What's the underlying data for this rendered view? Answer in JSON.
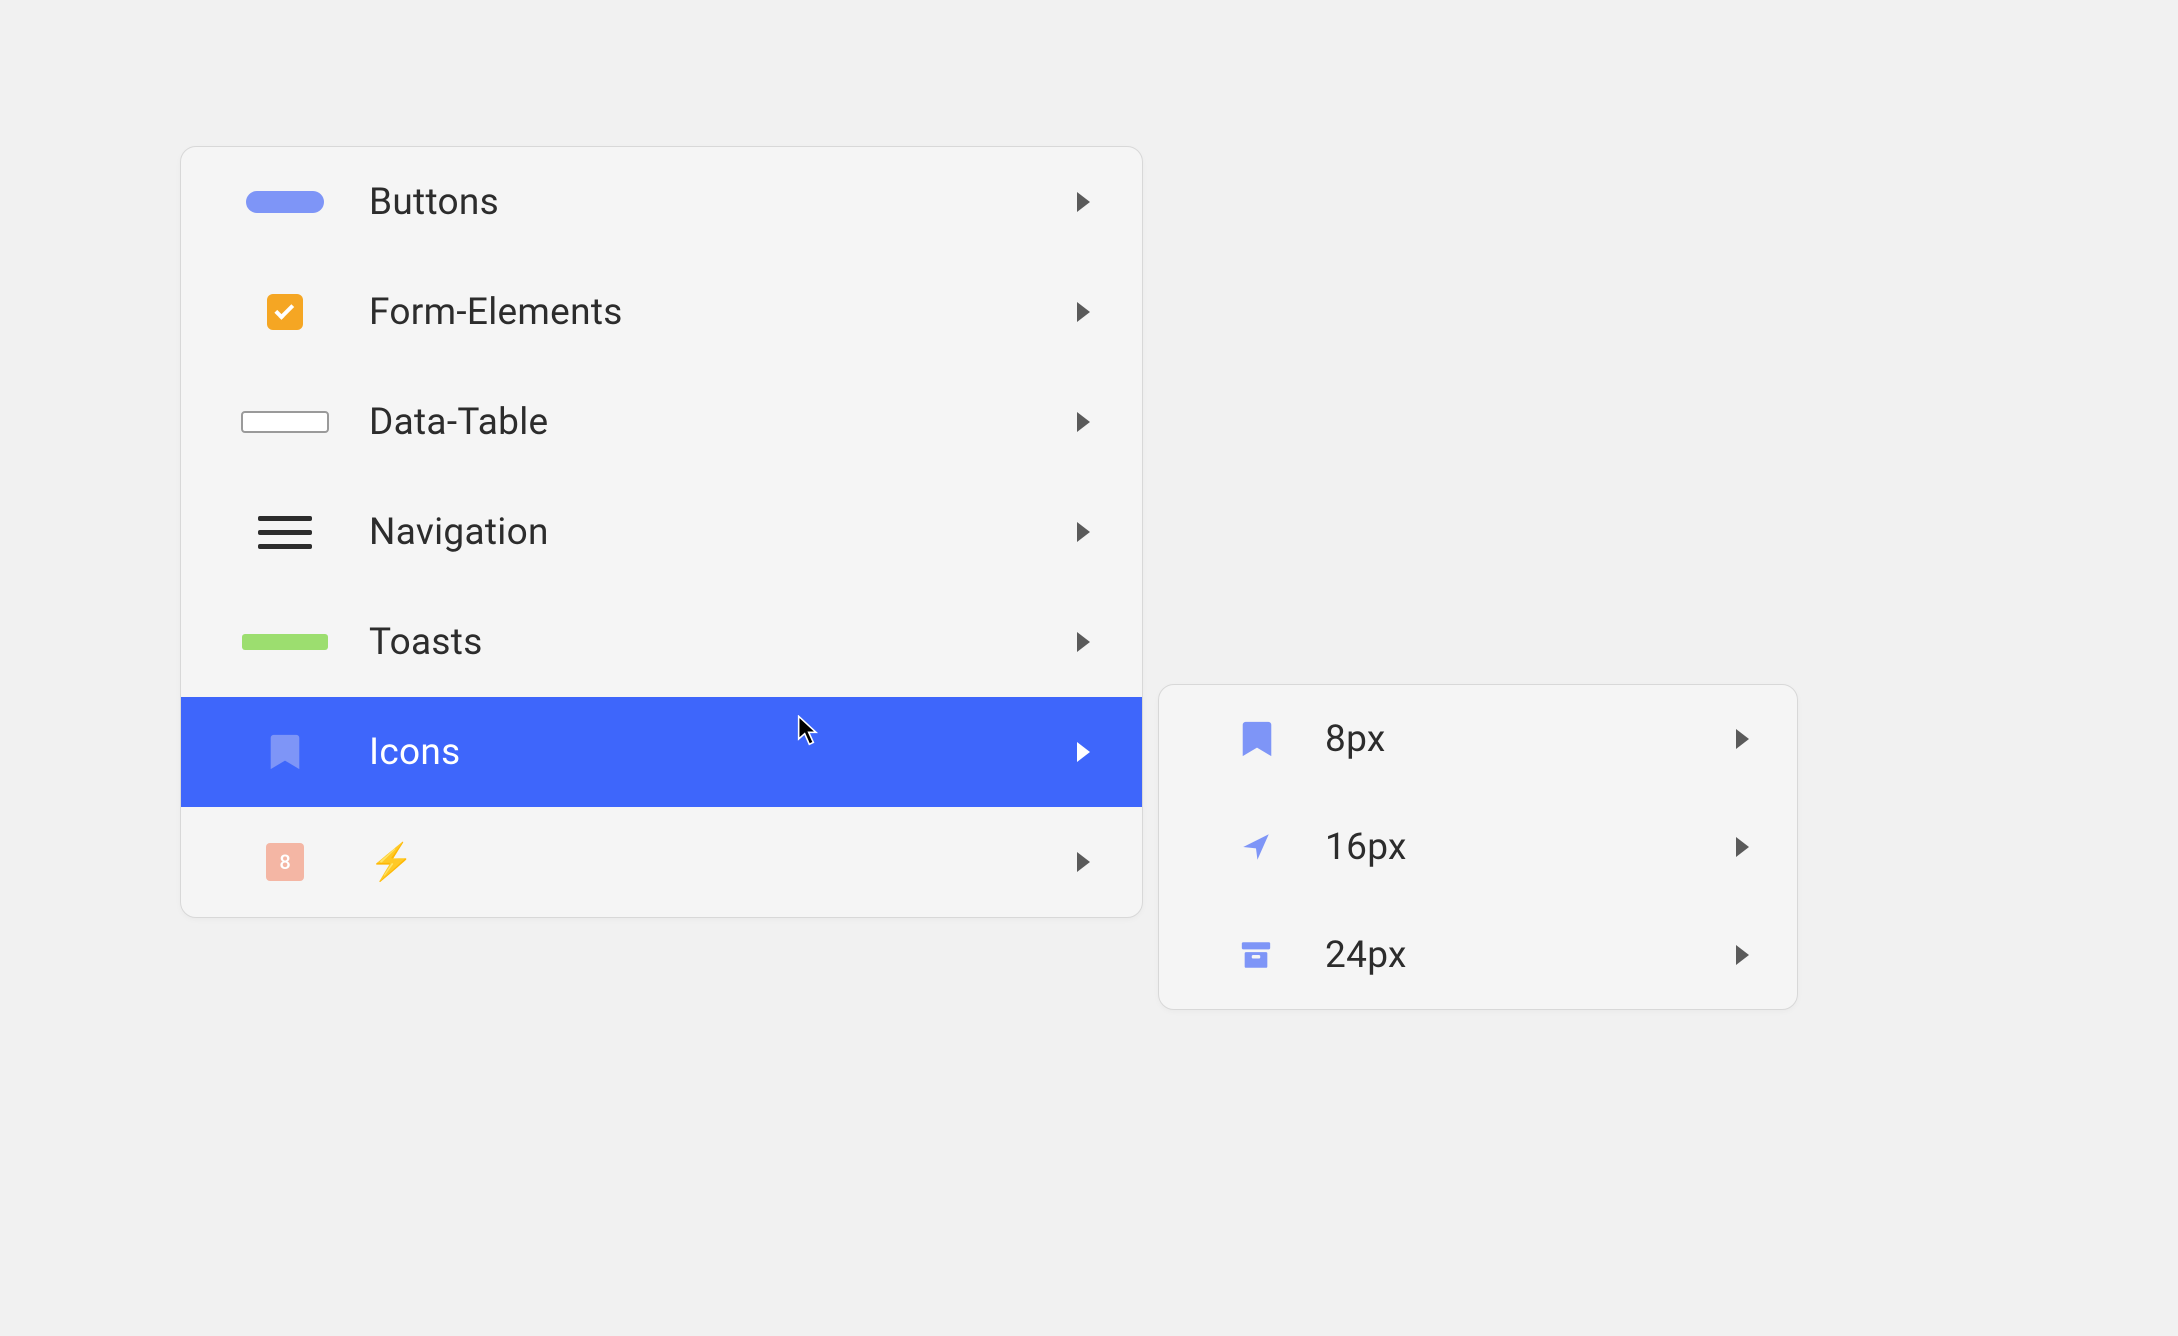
{
  "colors": {
    "accent": "#3e66fb",
    "accent_light": "#7e95f7",
    "checkbox_orange": "#f5a623",
    "toast_green": "#9cde6f",
    "badge_peach": "#f4b6a4",
    "text": "#2c2c2c"
  },
  "main_menu": {
    "items": [
      {
        "label": "Buttons",
        "icon": "pill-icon"
      },
      {
        "label": "Form-Elements",
        "icon": "checkbox-icon"
      },
      {
        "label": "Data-Table",
        "icon": "table-icon"
      },
      {
        "label": "Navigation",
        "icon": "nav-icon"
      },
      {
        "label": "Toasts",
        "icon": "toast-icon"
      },
      {
        "label": "Icons",
        "icon": "bookmark-icon",
        "active": true
      },
      {
        "label": "⚡",
        "icon": "badge-icon",
        "badge": "8"
      }
    ]
  },
  "sub_menu": {
    "items": [
      {
        "label": "8px",
        "icon": "bookmark-icon"
      },
      {
        "label": "16px",
        "icon": "nav-arrow-icon"
      },
      {
        "label": "24px",
        "icon": "archive-icon"
      }
    ]
  }
}
